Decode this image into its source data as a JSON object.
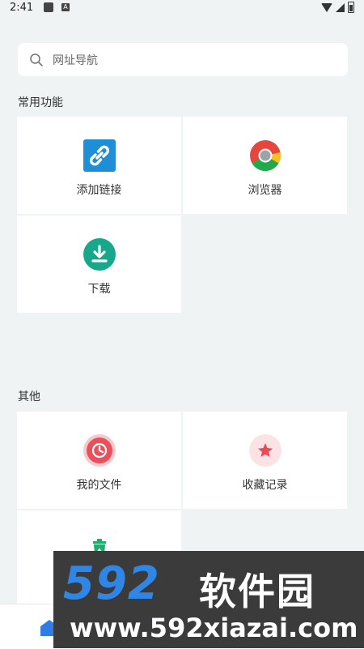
{
  "status_bar": {
    "time": "2:41",
    "badge": "A"
  },
  "search": {
    "placeholder": "网址导航"
  },
  "sections": [
    {
      "title": "常用功能",
      "items": [
        {
          "label": "添加链接",
          "icon": "link-icon",
          "color": "#1e8fd6"
        },
        {
          "label": "浏览器",
          "icon": "chrome-browser-icon",
          "color": "#e8453c"
        },
        {
          "label": "下载",
          "icon": "download-icon",
          "color": "#17a88b"
        }
      ]
    },
    {
      "title": "其他",
      "items": [
        {
          "label": "我的文件",
          "icon": "clock-icon",
          "color": "#e8505b"
        },
        {
          "label": "收藏记录",
          "icon": "star-icon",
          "color": "#e84a5a"
        },
        {
          "label": "",
          "icon": "recycle-bin-icon",
          "color": "#1fae6a"
        }
      ]
    }
  ],
  "watermark": {
    "brand": "592",
    "brand_cn": "软件园",
    "url": "www.592xiazai.com"
  }
}
